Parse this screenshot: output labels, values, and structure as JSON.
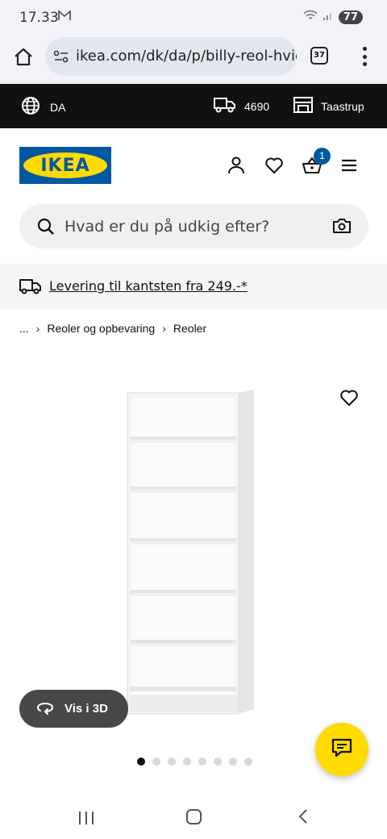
{
  "status_bar": {
    "time": "17.33",
    "battery": "77"
  },
  "browser": {
    "url": "ikea.com/dk/da/p/billy-reol-hvid",
    "tab_count": "37"
  },
  "utility_bar": {
    "language": "DA",
    "postal_code": "4690",
    "store": "Taastrup"
  },
  "header": {
    "logo_text": "IKEA",
    "cart_count": "1"
  },
  "search": {
    "placeholder": "Hvad er du på udkig efter?"
  },
  "delivery_banner": {
    "text": "Levering til kantsten fra 249.-*"
  },
  "breadcrumb": {
    "ellipsis": "...",
    "items": [
      "Reoler og opbevaring",
      "Reoler"
    ]
  },
  "product": {
    "view_3d_label": "Vis i 3D",
    "image_count": 8,
    "active_image": 1
  },
  "colors": {
    "ikea_blue": "#0058a3",
    "ikea_yellow": "#ffdb00",
    "utility_bar_bg": "#111111"
  }
}
